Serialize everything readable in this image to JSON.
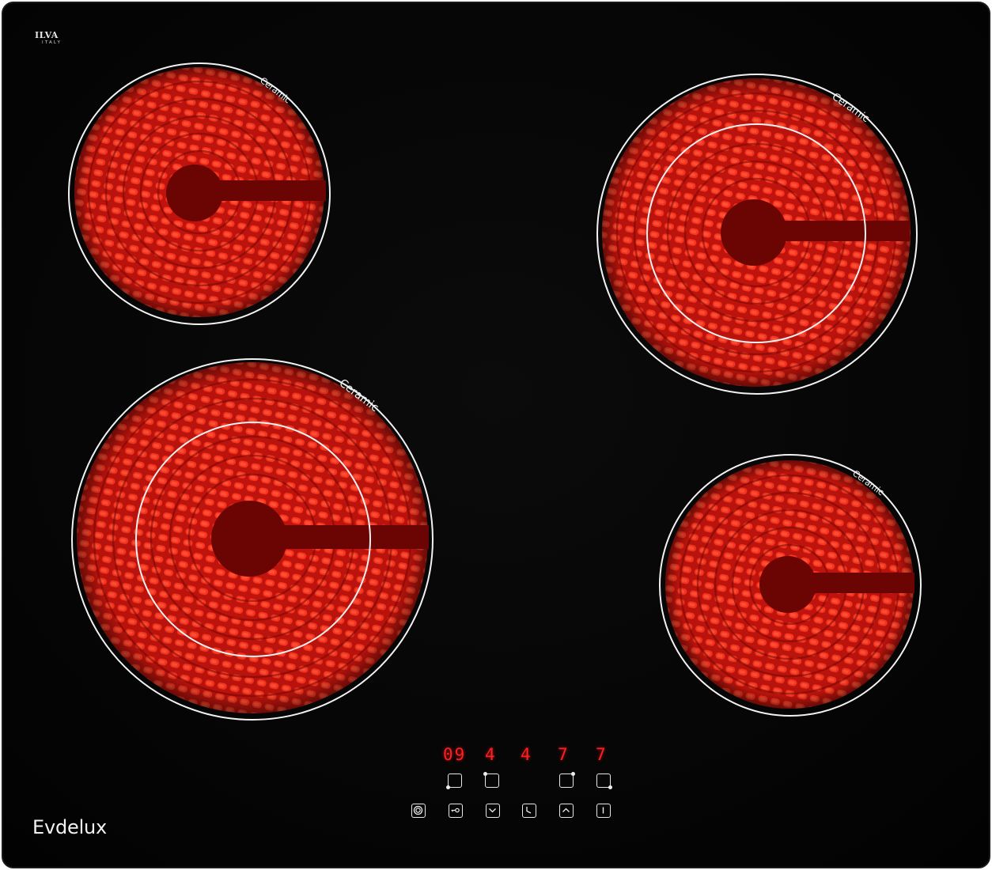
{
  "brand": {
    "top_logo_name": "ILVA",
    "top_logo_sub": "ITALY",
    "bottom_logo": "Evdelux"
  },
  "burners": [
    {
      "label": "Ceramic",
      "dual_zone": false
    },
    {
      "label": "Ceramic",
      "dual_zone": true
    },
    {
      "label": "Ceramic",
      "dual_zone": true
    },
    {
      "label": "Ceramic",
      "dual_zone": false
    }
  ],
  "control_panel": {
    "displays": [
      "09",
      "4",
      "4",
      "7",
      "7"
    ],
    "zone_keys": [
      "zone-rear-left",
      "zone-front-left",
      "zone-rear-right",
      "zone-front-right"
    ],
    "function_keys": [
      "power-icon",
      "key-lock-icon",
      "minus-icon",
      "timer-icon",
      "plus-icon",
      "dual-zone-icon"
    ]
  },
  "colors": {
    "glass": "#040404",
    "element_glow": "#ff2a15",
    "display_red": "#ff1f1f",
    "ring_white": "#f2f2f2"
  }
}
